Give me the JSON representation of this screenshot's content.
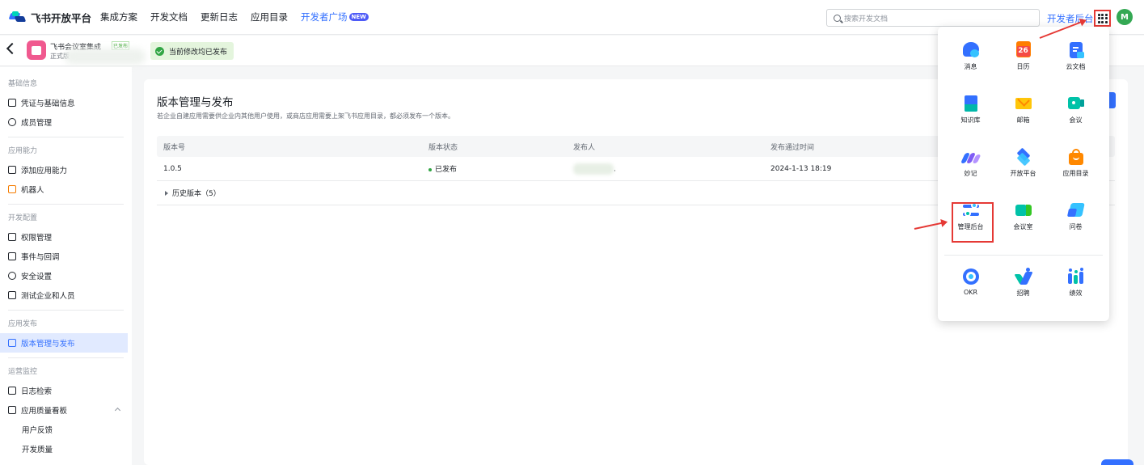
{
  "topnav": {
    "logo_text": "飞书开放平台",
    "items": [
      "集成方案",
      "开发文档",
      "更新日志",
      "应用目录"
    ],
    "dev_square": "开发者广场",
    "new_badge": "NEW",
    "search_placeholder": "搜索开发文档",
    "dev_backend": "开发者后台",
    "avatar_letter": "M"
  },
  "app": {
    "name": "飞书会议室集成",
    "tag": "已发布",
    "sub": "正式版",
    "notice": "当前修改均已发布"
  },
  "sidebar": {
    "sections": [
      {
        "title": "基础信息",
        "items": [
          "凭证与基础信息",
          "成员管理"
        ]
      },
      {
        "title": "应用能力",
        "items": [
          "添加应用能力",
          "机器人"
        ]
      },
      {
        "title": "开发配置",
        "items": [
          "权限管理",
          "事件与回调",
          "安全设置",
          "测试企业和人员"
        ]
      },
      {
        "title": "应用发布",
        "items": [
          "版本管理与发布"
        ]
      },
      {
        "title": "运营监控",
        "items": [
          "日志检索",
          "应用质量看板"
        ],
        "subitems": [
          "用户反馈",
          "开发质量"
        ]
      }
    ]
  },
  "main": {
    "title": "版本管理与发布",
    "desc": "若企业自建应用需要供企业内其他用户使用，或商店应用需要上架飞书应用目录，都必须发布一个版本。",
    "columns": [
      "版本号",
      "版本状态",
      "发布人",
      "发布通过时间"
    ],
    "rows": [
      {
        "version": "1.0.5",
        "status": "已发布",
        "publisher": ".",
        "time": "2024-1-13 18:19"
      }
    ],
    "history": "历史版本（5）"
  },
  "panel": {
    "items": [
      "消息",
      "日历",
      "云文档",
      "知识库",
      "邮箱",
      "会议",
      "妙记",
      "开放平台",
      "应用目录",
      "管理后台",
      "会议室",
      "问卷",
      "OKR",
      "招聘",
      "绩效"
    ],
    "calendar_day": "26"
  },
  "colors": {
    "accent": "#3370ff",
    "annotation_red": "#e53935",
    "success": "#32a645"
  }
}
